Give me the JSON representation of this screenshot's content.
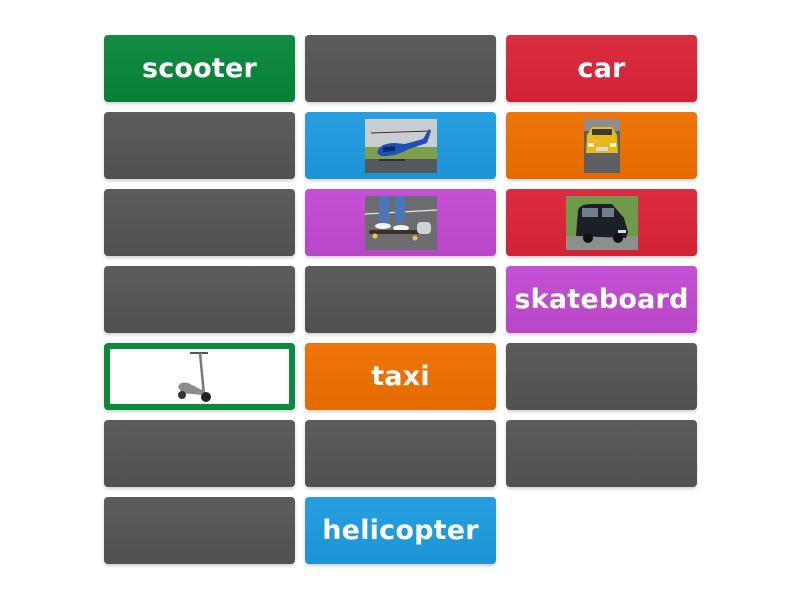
{
  "activity": {
    "type": "match-up",
    "tiles": [
      {
        "kind": "word",
        "text": "scooter",
        "color": "#08873a"
      },
      {
        "kind": "hidden"
      },
      {
        "kind": "word",
        "text": "car",
        "color": "#dc2438"
      },
      {
        "kind": "hidden"
      },
      {
        "kind": "image",
        "image": "helicopter-photo",
        "color": "#1e9be0"
      },
      {
        "kind": "image",
        "image": "taxi-photo",
        "color": "#ef7000"
      },
      {
        "kind": "hidden"
      },
      {
        "kind": "image",
        "image": "skateboard-photo",
        "color": "#c24ad2"
      },
      {
        "kind": "image",
        "image": "car-photo",
        "color": "#dc2438"
      },
      {
        "kind": "hidden"
      },
      {
        "kind": "hidden"
      },
      {
        "kind": "word",
        "text": "skateboard",
        "color": "#c24ad2"
      },
      {
        "kind": "image",
        "image": "scooter-photo",
        "color": "#0a8a3a",
        "state": "selected"
      },
      {
        "kind": "word",
        "text": "taxi",
        "color": "#ef7000"
      },
      {
        "kind": "hidden"
      },
      {
        "kind": "hidden"
      },
      {
        "kind": "hidden"
      },
      {
        "kind": "hidden"
      },
      {
        "kind": "hidden"
      },
      {
        "kind": "word",
        "text": "helicopter",
        "color": "#1e9be0"
      }
    ],
    "words": {
      "scooter": "scooter",
      "car": "car",
      "skateboard": "skateboard",
      "taxi": "taxi",
      "helicopter": "helicopter"
    },
    "hidden_tile_color": "#555555"
  }
}
